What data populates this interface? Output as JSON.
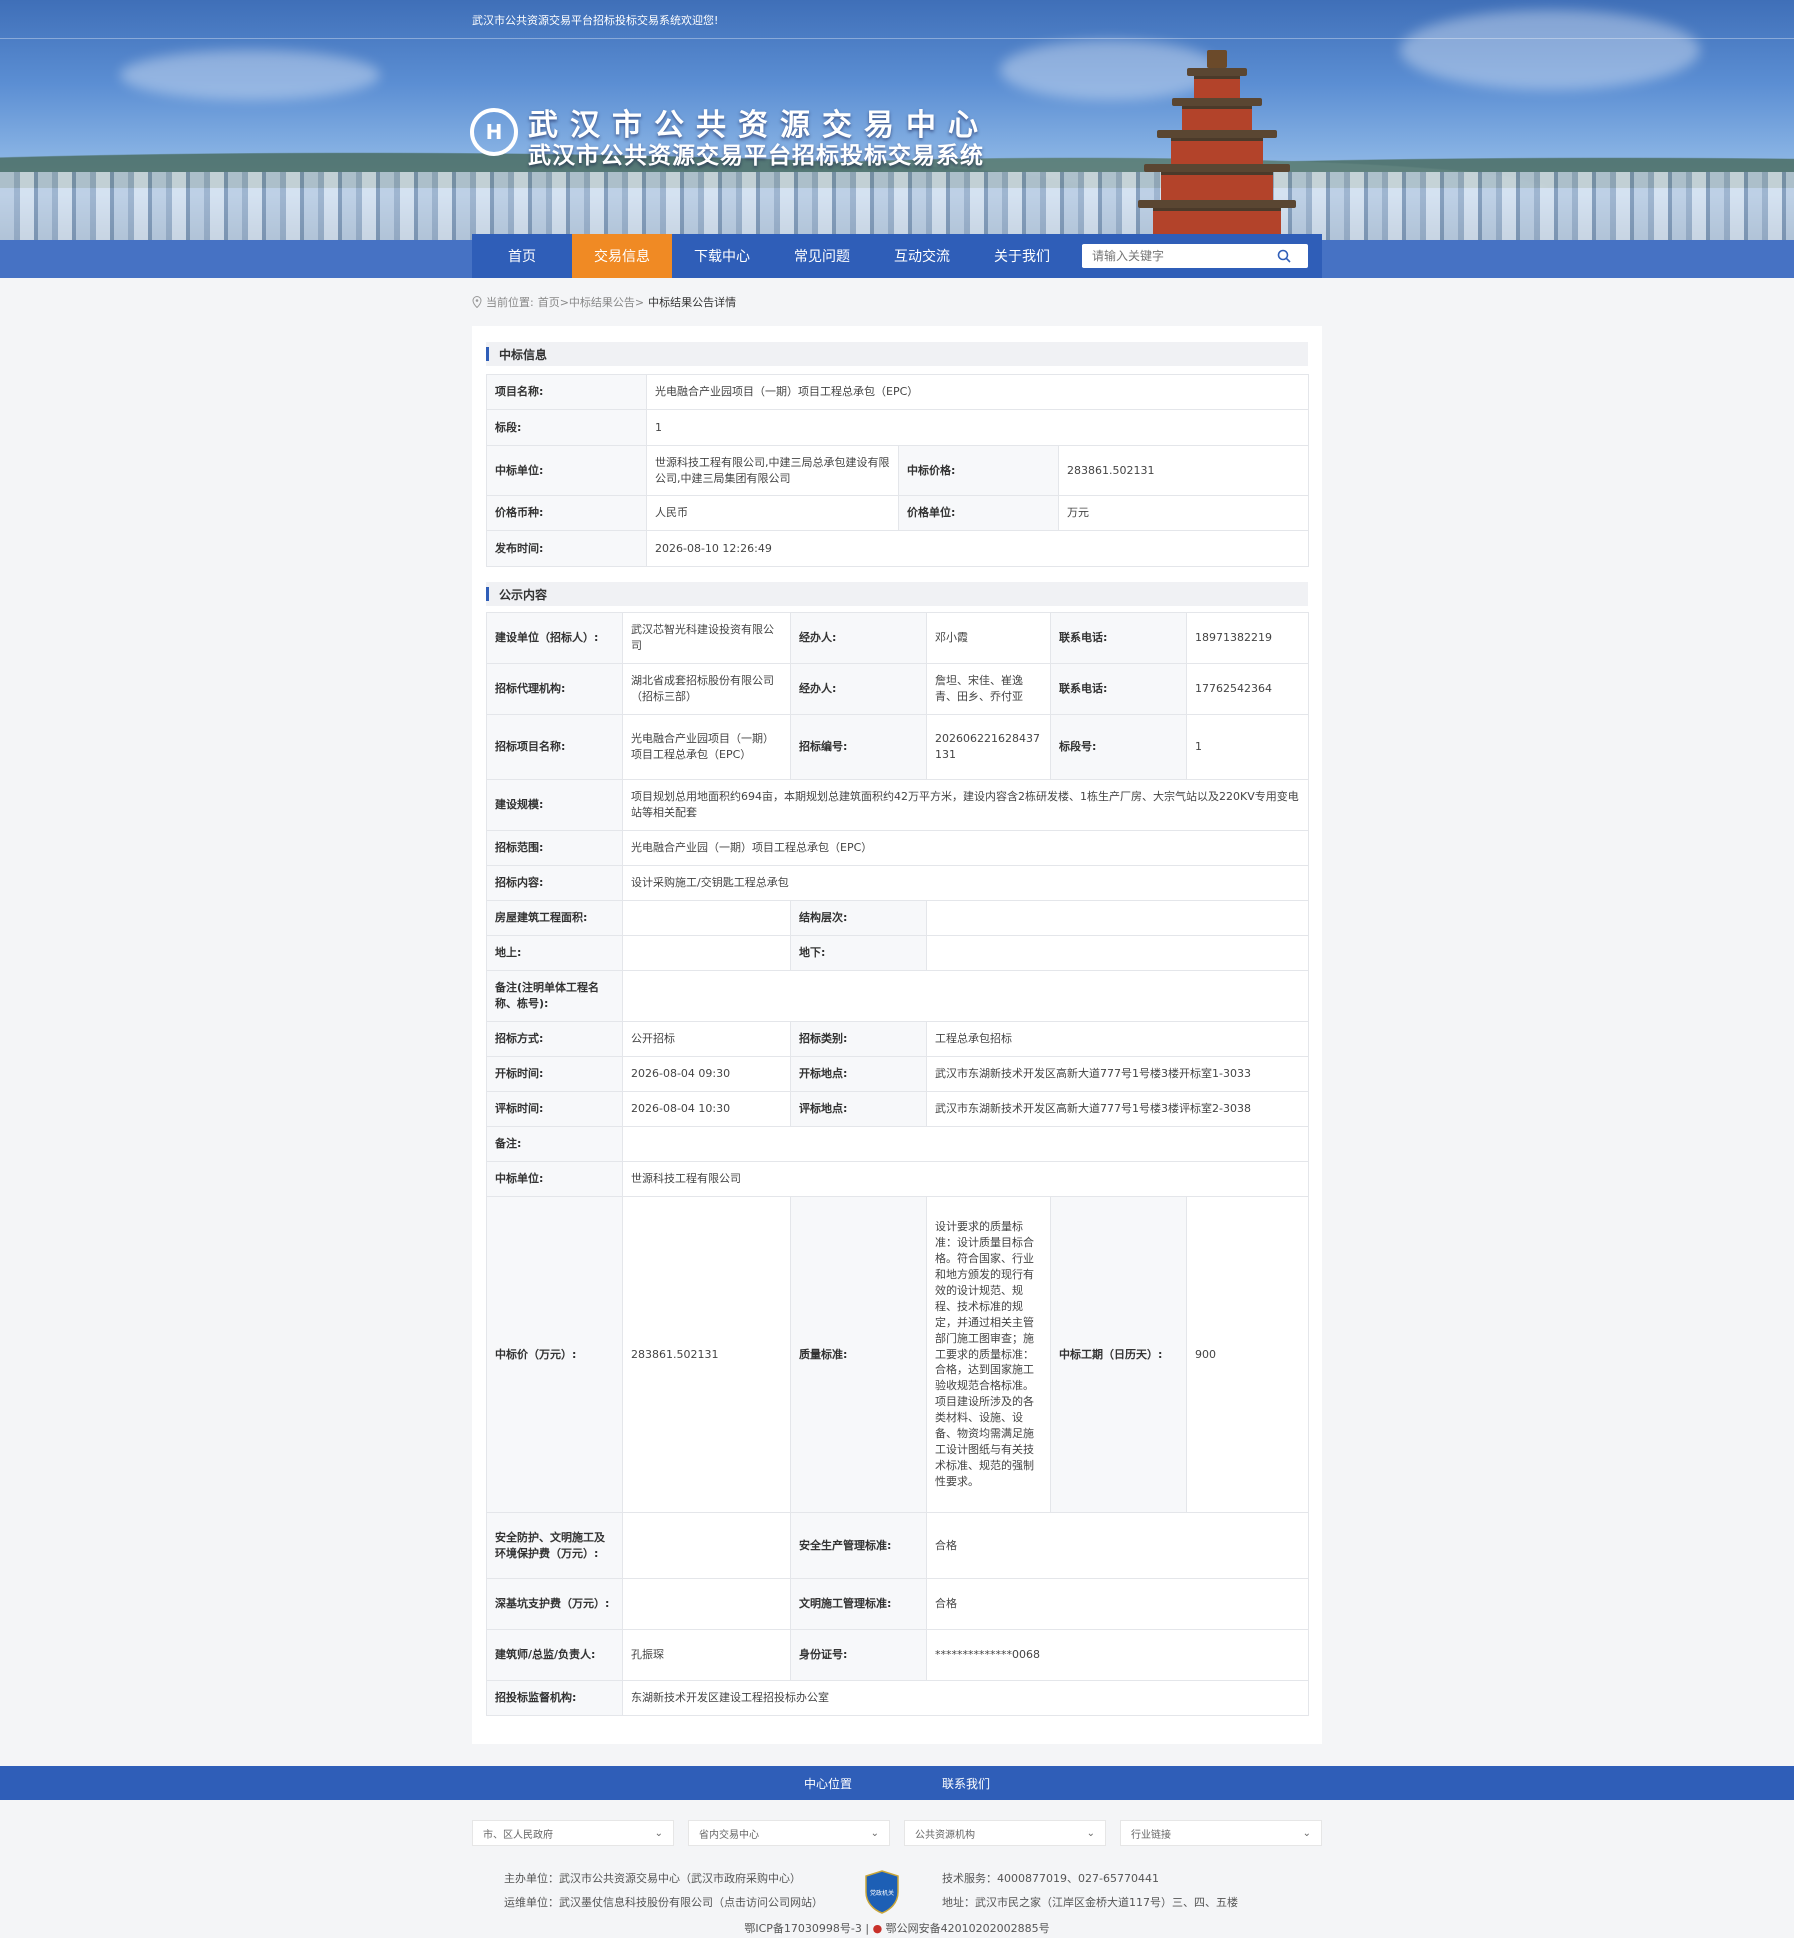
{
  "header": {
    "welcome": "武汉市公共资源交易平台招标投标交易系统欢迎您!",
    "title_line1": "武汉市公共资源交易中心",
    "title_line2": "武汉市公共资源交易平台招标投标交易系统",
    "logo_letter": "H"
  },
  "nav": {
    "items": [
      "首页",
      "交易信息",
      "下载中心",
      "常见问题",
      "互动交流",
      "关于我们"
    ],
    "active_index": 1,
    "search_placeholder": "请输入关键字"
  },
  "breadcrumb": {
    "prefix": "当前位置:",
    "path": "首页>中标结果公告>",
    "current": "中标结果公告详情"
  },
  "section1": {
    "title": "中标信息",
    "project_name_label": "项目名称:",
    "project_name": "光电融合产业园项目（一期）项目工程总承包（EPC）",
    "section_label": "标段:",
    "section": "1",
    "winner_label": "中标单位:",
    "winner": "世源科技工程有限公司,中建三局总承包建设有限公司,中建三局集团有限公司",
    "price_label": "中标价格:",
    "price": "283861.502131",
    "currency_label": "价格币种:",
    "currency": "人民币",
    "unit_label": "价格单位:",
    "unit": "万元",
    "publish_label": "发布时间:",
    "publish_time": "2026-08-10 12:26:49"
  },
  "section2": {
    "title": "公示内容",
    "builder_label": "建设单位（招标人）:",
    "builder": "武汉芯智光科建设投资有限公司",
    "handler_label": "经办人:",
    "handler1": "邓小霞",
    "phone_label": "联系电话:",
    "phone1": "18971382219",
    "agency_label": "招标代理机构:",
    "agency": "湖北省成套招标股份有限公司（招标三部）",
    "handler2": "詹坦、宋佳、崔逸青、田乡、乔付亚",
    "phone2": "17762542364",
    "proj_name_label": "招标项目名称:",
    "proj_name": "光电融合产业园项目（一期）项目工程总承包（EPC）",
    "code_label": "招标编号:",
    "code": "202606221628437131",
    "section_no_label": "标段号:",
    "section_no": "1",
    "scale_label": "建设规模:",
    "scale": "项目规划总用地面积约694亩，本期规划总建筑面积约42万平方米，建设内容含2栋研发楼、1栋生产厂房、大宗气站以及220KV专用变电站等相关配套",
    "scope_label": "招标范围:",
    "scope": "光电融合产业园（一期）项目工程总承包（EPC）",
    "content_label": "招标内容:",
    "content": "设计采购施工/交钥匙工程总承包",
    "area_label": "房屋建筑工程面积:",
    "area": "",
    "floors_label": "结构层次:",
    "floors": "",
    "above_label": "地上:",
    "above": "",
    "below_label": "地下:",
    "below": "",
    "remark_unit_label": "备注(注明单体工程名称、栋号):",
    "remark_unit": "",
    "method_label": "招标方式:",
    "method": "公开招标",
    "category_label": "招标类别:",
    "category": "工程总承包招标",
    "open_time_label": "开标时间:",
    "open_time": "2026-08-04 09:30",
    "open_place_label": "开标地点:",
    "open_place": "武汉市东湖新技术开发区高新大道777号1号楼3楼开标室1-3033",
    "eval_time_label": "评标时间:",
    "eval_time": "2026-08-04 10:30",
    "eval_place_label": "评标地点:",
    "eval_place": "武汉市东湖新技术开发区高新大道777号1号楼3楼评标室2-3038",
    "remark_label": "备注:",
    "remark": "",
    "winner_label": "中标单位:",
    "winner": "世源科技工程有限公司",
    "bid_price_label": "中标价（万元）:",
    "bid_price": "283861.502131",
    "quality_label": "质量标准:",
    "quality": "设计要求的质量标准：设计质量目标合格。符合国家、行业和地方颁发的现行有效的设计规范、规程、技术标准的规定，并通过相关主管部门施工图审查；施工要求的质量标准：合格，达到国家施工验收规范合格标准。项目建设所涉及的各类材料、设施、设备、物资均需满足施工设计图纸与有关技术标准、规范的强制性要求。",
    "period_label": "中标工期（日历天）:",
    "period": "900",
    "safety_fee_label": "安全防护、文明施工及环境保护费（万元）:",
    "safety_fee": "",
    "safety_std_label": "安全生产管理标准:",
    "safety_std": "合格",
    "pit_fee_label": "深基坑支护费（万元）:",
    "pit_fee": "",
    "civil_std_label": "文明施工管理标准:",
    "civil_std": "合格",
    "architect_label": "建筑师/总监/负责人:",
    "architect": "孔振琛",
    "id_label": "身份证号:",
    "id_no": "**************0068",
    "supervisor_label": "招投标监督机构:",
    "supervisor": "东湖新技术开发区建设工程招投标办公室"
  },
  "footer": {
    "bar_links": [
      "中心位置",
      "联系我们"
    ],
    "selects": [
      "市、区人民政府",
      "省内交易中心",
      "公共资源机构",
      "行业链接"
    ],
    "host": "主办单位：武汉市公共资源交易中心（武汉市政府采购中心）",
    "operator": "运维单位：武汉墨仗信息科技股份有限公司（点击访问公司网站）",
    "tech": "技术服务：4000877019、027-65770441",
    "address": "地址：武汉市民之家（江岸区金桥大道117号）三、四、五楼",
    "badge_text": "党政机关",
    "icp": "鄂ICP备17030998号-3",
    "police": "鄂公网安备42010202002885号"
  },
  "colors": {
    "nav_blue": "#2f5eb8",
    "nav_active": "#f08a24"
  }
}
